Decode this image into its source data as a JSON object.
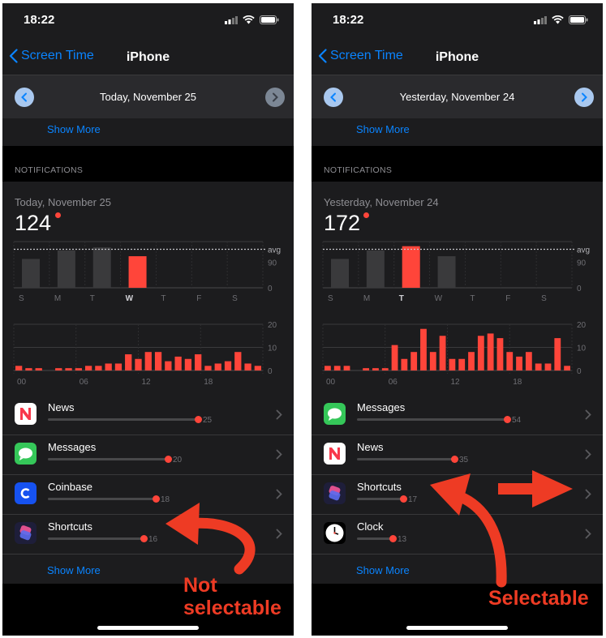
{
  "colors": {
    "accent": "#0a84ff",
    "bar_red": "#ff453a",
    "bar_gray": "#3a3a3c",
    "annotation": "#ee3b24"
  },
  "left": {
    "status": {
      "time": "18:22"
    },
    "nav": {
      "back_label": "Screen Time",
      "title": "iPhone"
    },
    "date": {
      "label": "Today, November 25",
      "prev_enabled": true,
      "next_enabled": false
    },
    "show_more_top": "Show More",
    "section_title": "NOTIFICATIONS",
    "summary": {
      "day_label": "Today, November 25",
      "count": "124"
    },
    "weekly": {
      "days": [
        "S",
        "M",
        "T",
        "W",
        "T",
        "F",
        "S"
      ],
      "selected_index": 3,
      "values": [
        0,
        75,
        97,
        105,
        82,
        0,
        0,
        0
      ],
      "series_values": [
        75,
        97,
        105,
        82
      ],
      "avg_label": "avg",
      "tick_90": "90",
      "tick_0": "0"
    },
    "hourly": {
      "values": [
        2,
        1,
        1,
        0,
        1,
        1,
        1,
        2,
        2,
        3,
        3,
        7,
        5,
        8,
        8,
        4,
        6,
        5,
        7,
        2,
        3,
        4,
        8,
        3,
        2
      ],
      "ticks": [
        "00",
        "06",
        "12",
        "18"
      ],
      "y_ticks": [
        "20",
        "10",
        "0"
      ]
    },
    "apps": [
      {
        "name": "News",
        "count": "25",
        "fraction": 1.0,
        "icon": "news-icon"
      },
      {
        "name": "Messages",
        "count": "20",
        "fraction": 0.8,
        "icon": "messages-icon"
      },
      {
        "name": "Coinbase",
        "count": "18",
        "fraction": 0.72,
        "icon": "coinbase-icon"
      },
      {
        "name": "Shortcuts",
        "count": "16",
        "fraction": 0.64,
        "icon": "shortcuts-icon"
      }
    ],
    "show_more_bottom": "Show More",
    "annotation": "Not selectable"
  },
  "right": {
    "status": {
      "time": "18:22"
    },
    "nav": {
      "back_label": "Screen Time",
      "title": "iPhone"
    },
    "date": {
      "label": "Yesterday, November 24",
      "prev_enabled": true,
      "next_enabled": true
    },
    "show_more_top": "Show More",
    "section_title": "NOTIFICATIONS",
    "summary": {
      "day_label": "Yesterday, November 24",
      "count": "172"
    },
    "weekly": {
      "days": [
        "S",
        "M",
        "T",
        "W",
        "T",
        "F",
        "S"
      ],
      "selected_index": 2,
      "series_values": [
        75,
        97,
        108,
        82
      ],
      "avg_label": "avg",
      "tick_90": "90",
      "tick_0": "0"
    },
    "hourly": {
      "values": [
        2,
        2,
        2,
        0,
        1,
        1,
        1,
        11,
        5,
        8,
        18,
        8,
        15,
        5,
        5,
        8,
        15,
        16,
        14,
        8,
        6,
        8,
        3,
        3,
        14,
        2
      ],
      "ticks": [
        "00",
        "06",
        "12",
        "18"
      ],
      "y_ticks": [
        "20",
        "10",
        "0"
      ]
    },
    "apps": [
      {
        "name": "Messages",
        "count": "54",
        "fraction": 1.0,
        "icon": "messages-icon"
      },
      {
        "name": "News",
        "count": "35",
        "fraction": 0.65,
        "icon": "news-icon"
      },
      {
        "name": "Shortcuts",
        "count": "17",
        "fraction": 0.31,
        "icon": "shortcuts-icon"
      },
      {
        "name": "Clock",
        "count": "13",
        "fraction": 0.24,
        "icon": "clock-icon"
      }
    ],
    "show_more_bottom": "Show More",
    "annotation": "Selectable"
  }
}
